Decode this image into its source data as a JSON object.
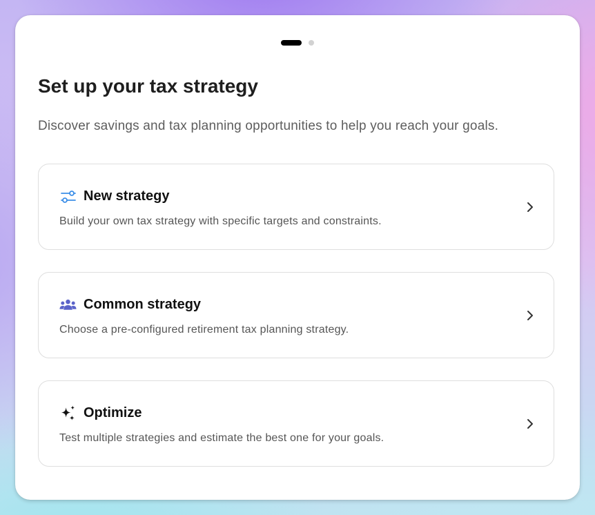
{
  "pager": {
    "count": 2,
    "active": 1
  },
  "header": {
    "title": "Set up your tax strategy",
    "subtitle": "Discover savings and tax planning opportunities to help you reach your goals."
  },
  "options": [
    {
      "icon": "sliders-icon",
      "title": "New strategy",
      "description": "Build your own tax strategy with specific targets and constraints."
    },
    {
      "icon": "people-group-icon",
      "title": "Common strategy",
      "description": "Choose a pre-configured retirement tax planning strategy."
    },
    {
      "icon": "sparkles-icon",
      "title": "Optimize",
      "description": "Test multiple strategies and estimate the best one for your goals."
    }
  ],
  "colors": {
    "sliders_icon": "#3b8ee8",
    "people_icon": "#5b63c9",
    "sparkles_icon": "#111111"
  }
}
